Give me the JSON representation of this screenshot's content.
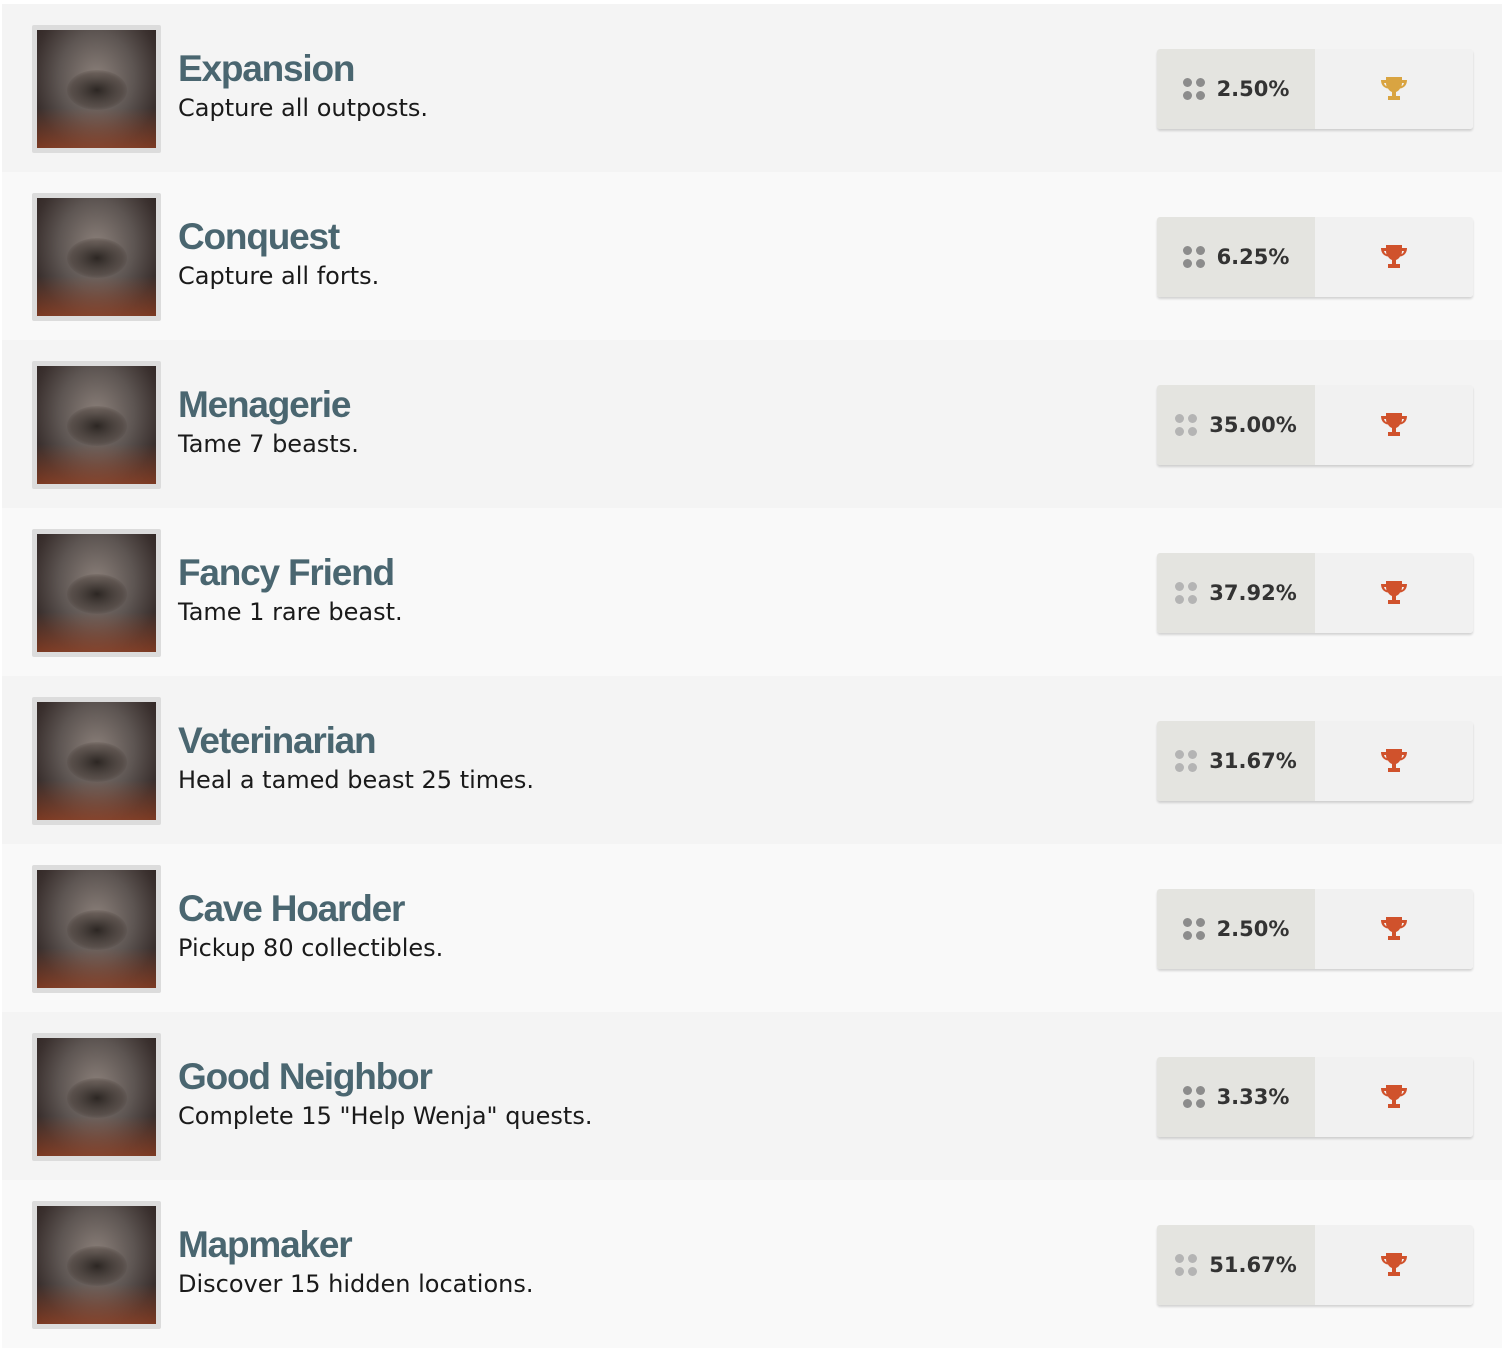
{
  "achievements": [
    {
      "title": "Expansion",
      "description": "Capture all outposts.",
      "percent": "2.50%",
      "trophy_icon": "trophy-gold-icon",
      "trophy_color": "#d9a441",
      "dots_style": "dark"
    },
    {
      "title": "Conquest",
      "description": "Capture all forts.",
      "percent": "6.25%",
      "trophy_icon": "trophy-bronze-icon",
      "trophy_color": "#d0522c",
      "dots_style": "dark"
    },
    {
      "title": "Menagerie",
      "description": "Tame 7 beasts.",
      "percent": "35.00%",
      "trophy_icon": "trophy-bronze-icon",
      "trophy_color": "#d0522c",
      "dots_style": "light"
    },
    {
      "title": "Fancy Friend",
      "description": "Tame 1 rare beast.",
      "percent": "37.92%",
      "trophy_icon": "trophy-bronze-icon",
      "trophy_color": "#d0522c",
      "dots_style": "light"
    },
    {
      "title": "Veterinarian",
      "description": "Heal a tamed beast 25 times.",
      "percent": "31.67%",
      "trophy_icon": "trophy-bronze-icon",
      "trophy_color": "#d0522c",
      "dots_style": "light"
    },
    {
      "title": "Cave Hoarder",
      "description": "Pickup 80 collectibles.",
      "percent": "2.50%",
      "trophy_icon": "trophy-bronze-icon",
      "trophy_color": "#d0522c",
      "dots_style": "dark"
    },
    {
      "title": "Good Neighbor",
      "description": "Complete 15 \"Help Wenja\" quests.",
      "percent": "3.33%",
      "trophy_icon": "trophy-bronze-icon",
      "trophy_color": "#d0522c",
      "dots_style": "dark"
    },
    {
      "title": "Mapmaker",
      "description": "Discover 15 hidden locations.",
      "percent": "51.67%",
      "trophy_icon": "trophy-bronze-icon",
      "trophy_color": "#d0522c",
      "dots_style": "light"
    }
  ]
}
